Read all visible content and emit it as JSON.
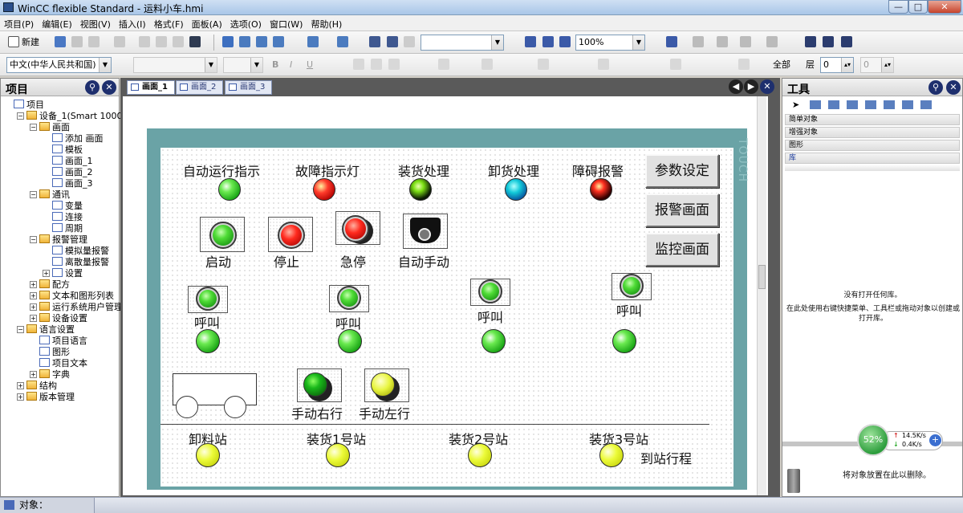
{
  "window": {
    "title": "WinCC flexible Standard - 运料小车.hmi",
    "controls": [
      "—",
      "□",
      "✕"
    ]
  },
  "menu": [
    "项目(P)",
    "编辑(E)",
    "视图(V)",
    "插入(I)",
    "格式(F)",
    "面板(A)",
    "选项(O)",
    "窗口(W)",
    "帮助(H)"
  ],
  "toolbar": {
    "new_label": "新建",
    "zoom": "100%",
    "language": "中文(中华人民共和国)",
    "all_label": "全部",
    "layer_label": "层",
    "layer_value": "0",
    "grid_value": "0"
  },
  "project_panel": {
    "title": "项目",
    "tree": [
      {
        "label": "项目",
        "level": 0
      },
      {
        "label": "设备_1(Smart 1000)",
        "level": 1,
        "pm": "-"
      },
      {
        "label": "画面",
        "level": 2,
        "pm": "-"
      },
      {
        "label": "添加 画面",
        "level": 3
      },
      {
        "label": "模板",
        "level": 3
      },
      {
        "label": "画面_1",
        "level": 3
      },
      {
        "label": "画面_2",
        "level": 3
      },
      {
        "label": "画面_3",
        "level": 3
      },
      {
        "label": "通讯",
        "level": 2,
        "pm": "-"
      },
      {
        "label": "变量",
        "level": 3
      },
      {
        "label": "连接",
        "level": 3
      },
      {
        "label": "周期",
        "level": 3
      },
      {
        "label": "报警管理",
        "level": 2,
        "pm": "-"
      },
      {
        "label": "模拟量报警",
        "level": 3
      },
      {
        "label": "离散量报警",
        "level": 3
      },
      {
        "label": "设置",
        "level": 3,
        "pm": "+"
      },
      {
        "label": "配方",
        "level": 2,
        "pm": "+"
      },
      {
        "label": "文本和图形列表",
        "level": 2,
        "pm": "+"
      },
      {
        "label": "运行系统用户管理",
        "level": 2,
        "pm": "+"
      },
      {
        "label": "设备设置",
        "level": 2,
        "pm": "+"
      },
      {
        "label": "语言设置",
        "level": 1,
        "pm": "-"
      },
      {
        "label": "项目语言",
        "level": 2
      },
      {
        "label": "图形",
        "level": 2
      },
      {
        "label": "项目文本",
        "level": 2
      },
      {
        "label": "字典",
        "level": 2,
        "pm": "+"
      },
      {
        "label": "结构",
        "level": 1,
        "pm": "+"
      },
      {
        "label": "版本管理",
        "level": 1,
        "pm": "+"
      }
    ]
  },
  "editor": {
    "tabs": [
      "画面_1",
      "画面_2",
      "画面_3"
    ],
    "active_tab": 0,
    "touch_label": "TOUCH"
  },
  "hmi": {
    "indicators": [
      {
        "label": "自动运行指示",
        "color": "green"
      },
      {
        "label": "故障指示灯",
        "color": "red"
      },
      {
        "label": "装货处理",
        "color": "dark-green"
      },
      {
        "label": "卸货处理",
        "color": "cyan"
      },
      {
        "label": "障碍报警",
        "color": "dark-red"
      }
    ],
    "buttons": [
      {
        "label": "启动"
      },
      {
        "label": "停止"
      },
      {
        "label": "急停"
      },
      {
        "label": "自动手动"
      }
    ],
    "calls": [
      {
        "label": "呼叫"
      },
      {
        "label": "呼叫"
      },
      {
        "label": "呼叫"
      },
      {
        "label": "呼叫"
      }
    ],
    "manual": [
      {
        "label": "手动右行"
      },
      {
        "label": "手动左行"
      }
    ],
    "stations": [
      {
        "label": "卸料站"
      },
      {
        "label": "装货1号站"
      },
      {
        "label": "装货2号站"
      },
      {
        "label": "装货3号站"
      }
    ],
    "trip_label": "到站行程",
    "nav_buttons": [
      "参数设定",
      "报警画面",
      "监控画面"
    ]
  },
  "tools_panel": {
    "title": "工具",
    "categories": [
      "简单对象",
      "增强对象",
      "图形",
      "库"
    ],
    "empty_msg": "没有打开任何库。",
    "hint_msg": "在此处使用右键快捷菜单、工具栏或拖动对象以创建或打开库。",
    "delete_msg": "将对象放置在此以删除。"
  },
  "network": {
    "percent": "52%",
    "up": "14.5K/s",
    "down": "0.4K/s"
  },
  "status": {
    "label": "对象："
  }
}
